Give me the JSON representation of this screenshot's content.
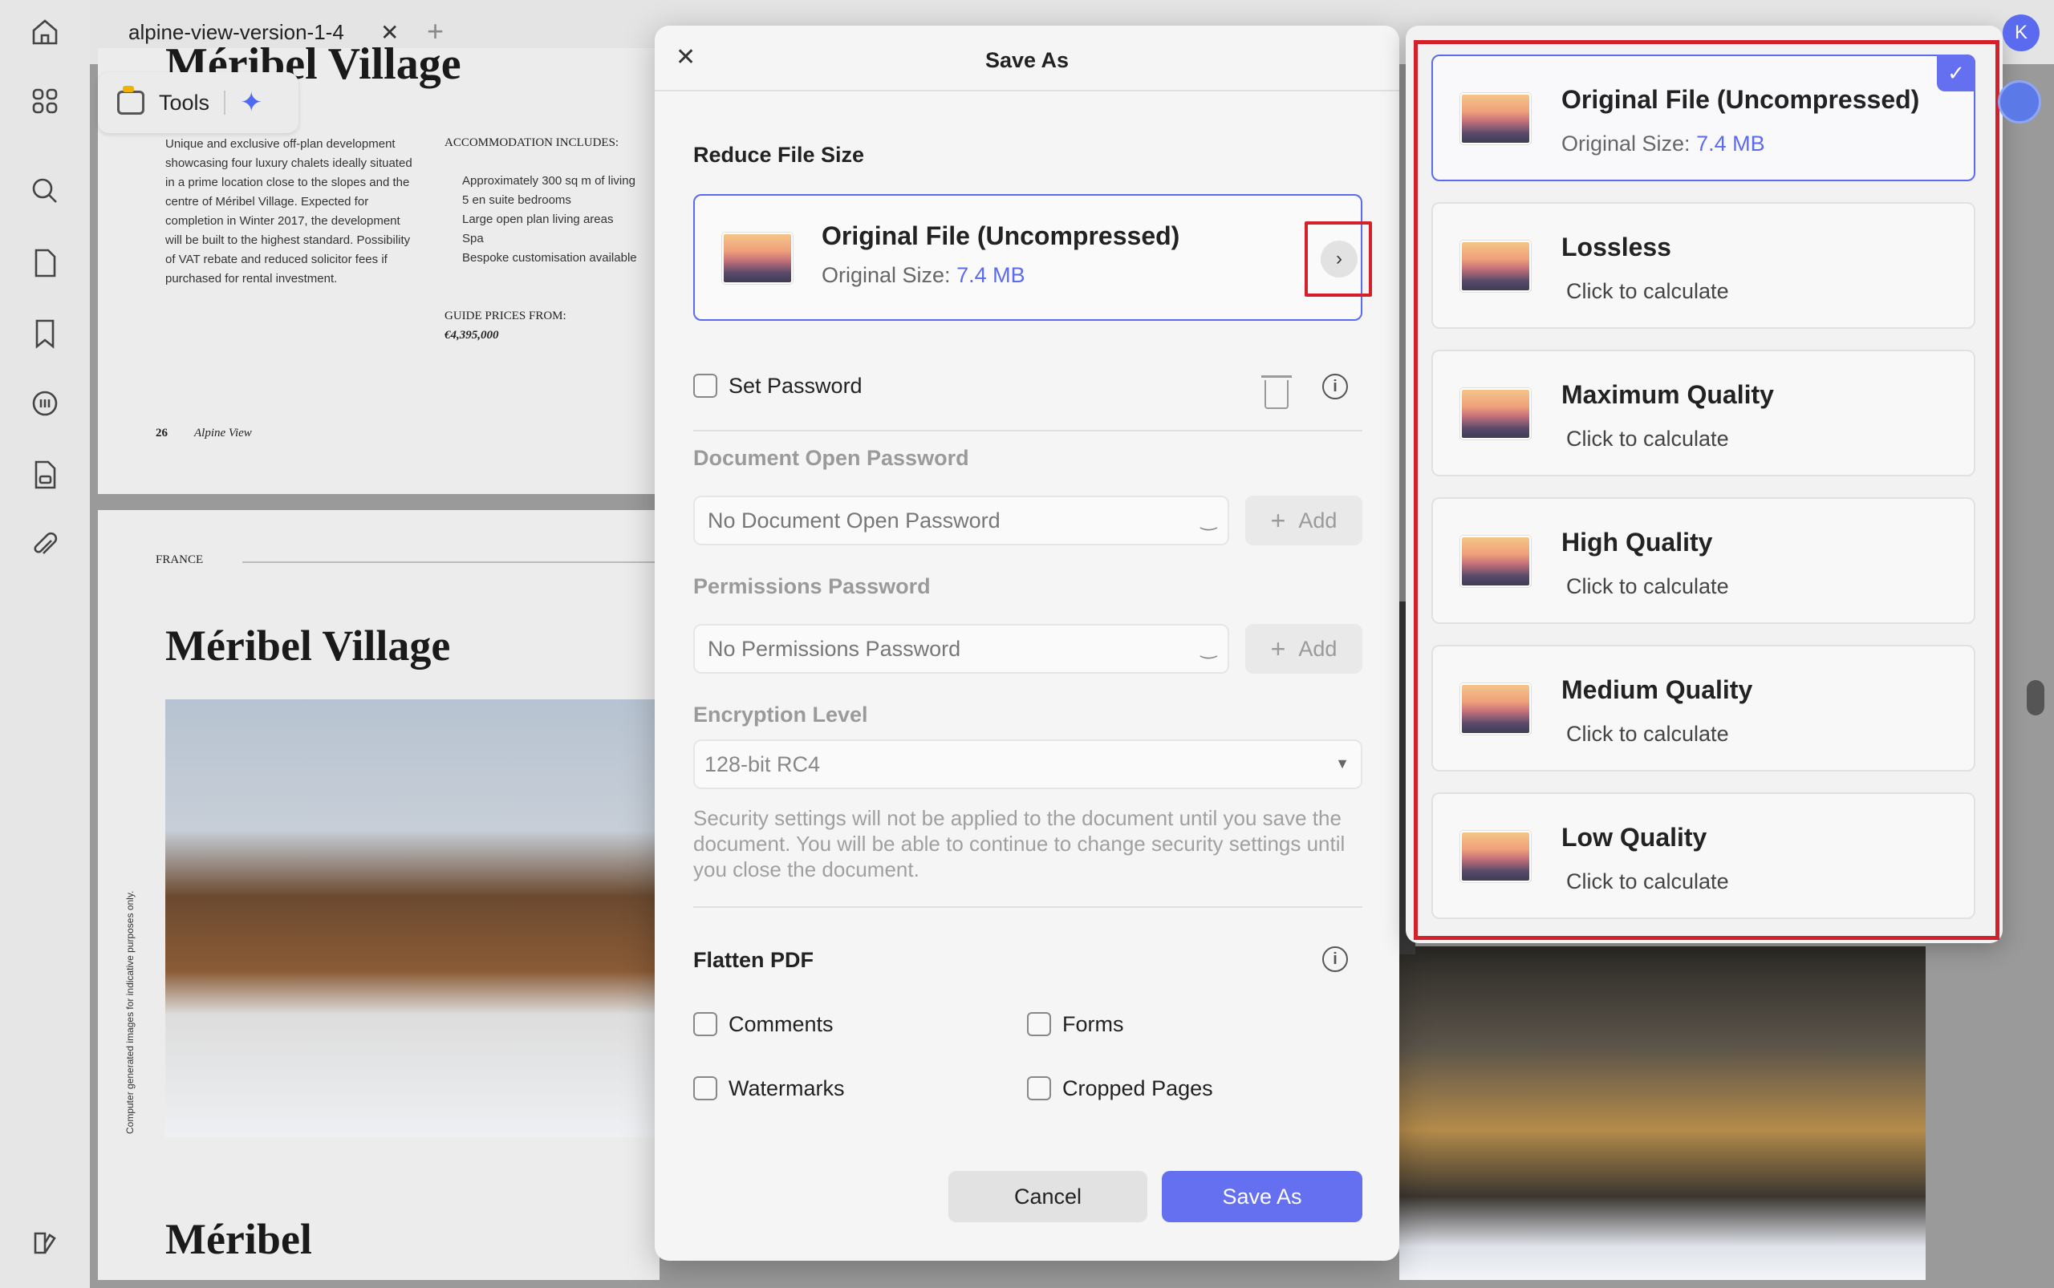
{
  "tab": {
    "title": "alpine-view-version-1-4",
    "close": "✕",
    "add": "+"
  },
  "toolbar": {
    "tools_label": "Tools"
  },
  "avatar": {
    "initial": "K"
  },
  "document": {
    "top_heading": "Méribel Village",
    "intro_text": "Unique and exclusive off-plan development showcasing four luxury chalets ideally situated in a prime location close to the slopes and the centre of Méribel Village. Expected for completion in Winter 2017, the development will be built to the highest standard. Possibility of VAT rebate and reduced solicitor fees if purchased for rental investment.",
    "accommodation_heading": "ACCOMMODATION INCLUDES:",
    "accommodation_items": [
      "Approximately 300 sq m of living",
      "5 en suite bedrooms",
      "Large open plan living areas",
      "Spa",
      "Bespoke customisation available"
    ],
    "guide_label": "GUIDE PRICES FROM:",
    "guide_price": "€4,395,000",
    "page_footer_number": "26",
    "page_footer_title": "Alpine View",
    "country": "FRANCE",
    "page2_heading": "Méribel Village",
    "page2_bottom_heading": "Méribel",
    "vertical_caption": "Computer generated images for indicative purposes only."
  },
  "dialog": {
    "title": "Save As",
    "close": "✕",
    "reduce_title": "Reduce File Size",
    "selected_option": {
      "title": "Original File (Uncompressed)",
      "size_prefix": "Original Size: ",
      "size": "7.4 MB"
    },
    "set_password_label": "Set Password",
    "doc_open_pw_title": "Document Open Password",
    "doc_open_pw_placeholder": "No Document Open Password",
    "perm_pw_title": "Permissions Password",
    "perm_pw_placeholder": "No Permissions Password",
    "add_label": "Add",
    "encryption_title": "Encryption Level",
    "encryption_value": "128-bit RC4",
    "security_note": "Security settings will not be applied to the document until you save the document. You will be able to continue to change security settings until you close the document.",
    "flatten_title": "Flatten PDF",
    "flatten_options": [
      "Comments",
      "Forms",
      "Watermarks",
      "Cropped Pages"
    ],
    "cancel_label": "Cancel",
    "save_label": "Save As"
  },
  "compression_options": [
    {
      "title": "Original File (Uncompressed)",
      "sub_prefix": "Original Size: ",
      "sub_value": "7.4 MB",
      "selected": true
    },
    {
      "title": "Lossless",
      "sub": "Click to calculate"
    },
    {
      "title": "Maximum Quality",
      "sub": "Click to calculate"
    },
    {
      "title": "High Quality",
      "sub": "Click to calculate"
    },
    {
      "title": "Medium Quality",
      "sub": "Click to calculate"
    },
    {
      "title": "Low Quality",
      "sub": "Click to calculate"
    }
  ],
  "colors": {
    "accent": "#6470ef",
    "highlight_box": "#d4202a"
  }
}
